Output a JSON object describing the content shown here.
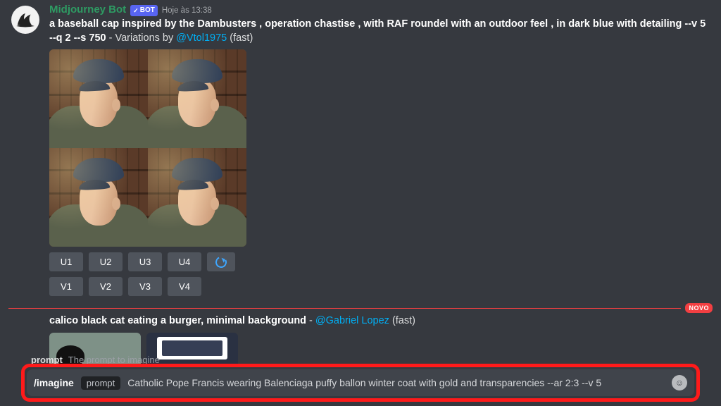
{
  "message1": {
    "username": "Midjourney Bot",
    "bot_tag": "BOT",
    "timestamp": "Hoje às 13:38",
    "prompt_bold": "a baseball cap inspired by the Dambusters , operation chastise , with RAF roundel with an outdoor feel , in dark blue with detailing --v 5 --q 2 --s 750",
    "dash": " - ",
    "variations_prefix": "Variations by ",
    "mention": "@Vtol1975",
    "mode_suffix": " (fast)",
    "buttons_u": [
      "U1",
      "U2",
      "U3",
      "U4"
    ],
    "buttons_v": [
      "V1",
      "V2",
      "V3",
      "V4"
    ]
  },
  "divider": {
    "label": "NOVO"
  },
  "message2": {
    "prompt_bold": "calico black cat eating a burger, minimal background",
    "dash": " - ",
    "mention": "@Gabriel Lopez",
    "mode_suffix": " (fast)"
  },
  "input_hint": {
    "label": "prompt",
    "desc": "The prompt to imagine"
  },
  "input": {
    "command": "/imagine",
    "param": "prompt",
    "value": "Catholic Pope Francis wearing Balenciaga puffy ballon winter coat with gold and transparencies --ar 2:3 --v 5"
  }
}
